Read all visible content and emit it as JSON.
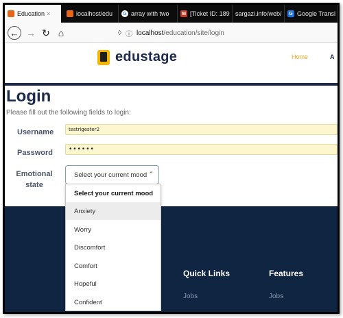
{
  "browser": {
    "tabs": [
      {
        "label": "Education",
        "icon": "orange-square-icon",
        "active": true
      },
      {
        "label": "localhost/edu",
        "icon": "orange-square-icon",
        "active": false
      },
      {
        "label": "array with two",
        "icon": "google-icon",
        "active": false
      },
      {
        "label": "[Ticket ID: 189",
        "icon": "mail-icon",
        "active": false
      },
      {
        "label": "sargazi.info/web/",
        "icon": "",
        "active": false
      },
      {
        "label": "Google Transl",
        "icon": "translate-icon",
        "active": false
      }
    ],
    "url_host": "localhost",
    "url_path": "/education/site/login"
  },
  "site": {
    "logo_text": "edustage",
    "nav_home": "Home",
    "nav_cutoff": "A"
  },
  "login": {
    "title": "Login",
    "subtitle": "Please fill out the following fields to login:",
    "username_label": "Username",
    "username_value": "testrigester2",
    "password_label": "Password",
    "password_value": "••••••",
    "emotional_label": "Emotional state",
    "mood_selected": "Select your current mood",
    "mood_options": [
      "Select your current mood",
      "Anxiety",
      "Worry",
      "Discomfort",
      "Comfort",
      "Hopeful",
      "Confident"
    ]
  },
  "footer": {
    "quick_links": "Quick Links",
    "features": "Features",
    "quick_links_item": "Jobs",
    "features_item": "Jobs"
  },
  "colors": {
    "navy": "#1b2a4a",
    "footer": "#0f2542",
    "accent": "#f5a623",
    "autofill": "#fcf7cf"
  }
}
